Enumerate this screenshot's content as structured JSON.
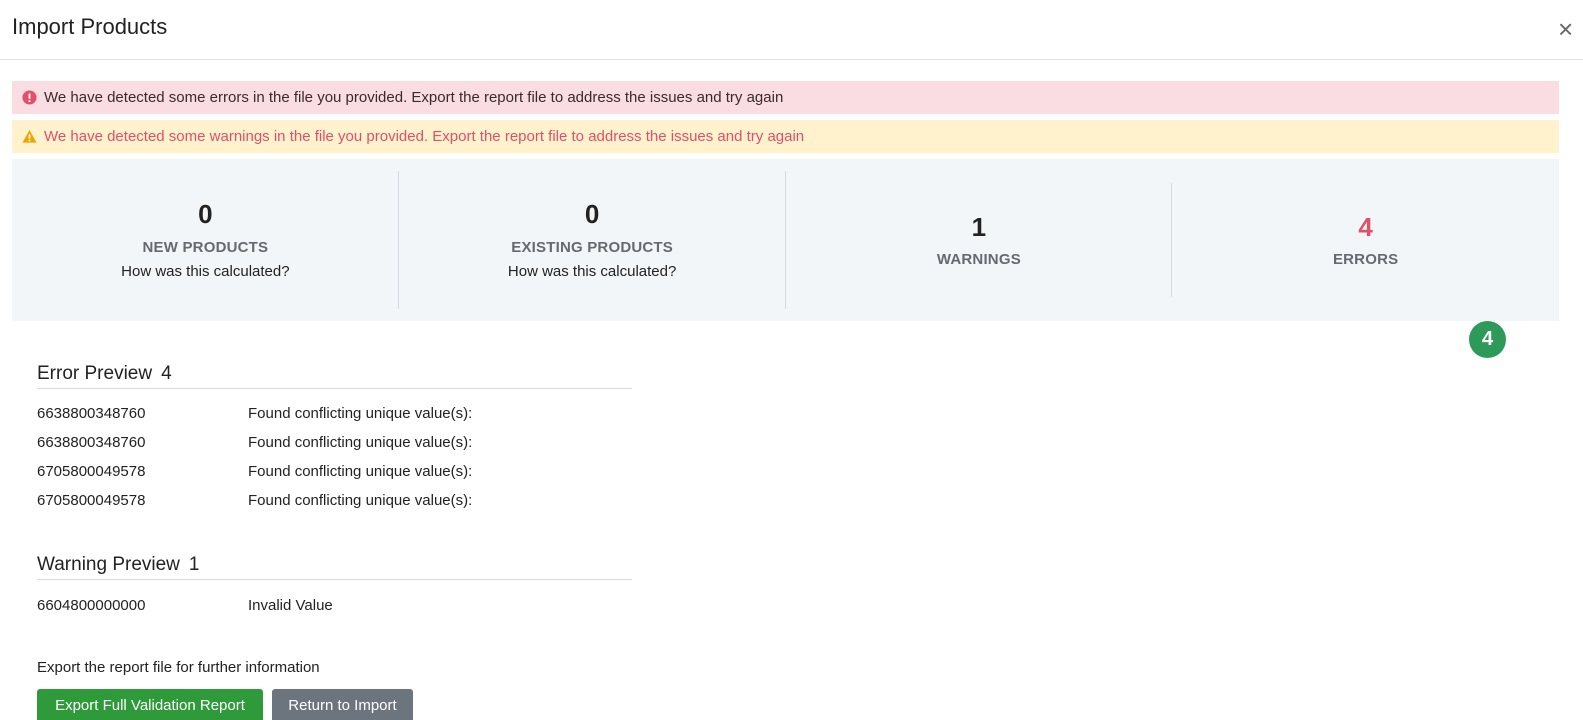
{
  "header": {
    "title": "Import Products",
    "close_symbol": "×"
  },
  "alerts": {
    "error": "We have detected some errors in the file you provided. Export the report file to address the issues and try again",
    "warning": "We have detected some warnings in the file you provided. Export the report file to address the issues and try again",
    "error_icon": "error-circle-icon",
    "warning_icon": "warning-triangle-icon",
    "error_color": "#e0506b",
    "warning_color": "#f0a400"
  },
  "stats": {
    "new_products": {
      "value": "0",
      "label": "NEW PRODUCTS",
      "link": "How was this calculated?"
    },
    "existing_products": {
      "value": "0",
      "label": "EXISTING PRODUCTS",
      "link": "How was this calculated?"
    },
    "warnings": {
      "value": "1",
      "label": "WARNINGS"
    },
    "errors": {
      "value": "4",
      "label": "ERRORS"
    }
  },
  "badge": {
    "value": "4",
    "color": "#2e9a5a"
  },
  "error_preview": {
    "title": "Error Preview",
    "count": "4",
    "rows": [
      {
        "code": "6638800348760",
        "message": "Found conflicting unique value(s):"
      },
      {
        "code": "6638800348760",
        "message": "Found conflicting unique value(s):"
      },
      {
        "code": "6705800049578",
        "message": "Found conflicting unique value(s):"
      },
      {
        "code": "6705800049578",
        "message": "Found conflicting unique value(s):"
      }
    ]
  },
  "warning_preview": {
    "title": "Warning Preview",
    "count": "1",
    "rows": [
      {
        "code": "6604800000000",
        "message": "Invalid Value"
      }
    ]
  },
  "footer": {
    "note": "Export the report file for further information",
    "export_button": "Export Full Validation Report",
    "return_button": "Return to Import",
    "export_color": "#2e9a3a",
    "return_color": "#6c757d"
  }
}
